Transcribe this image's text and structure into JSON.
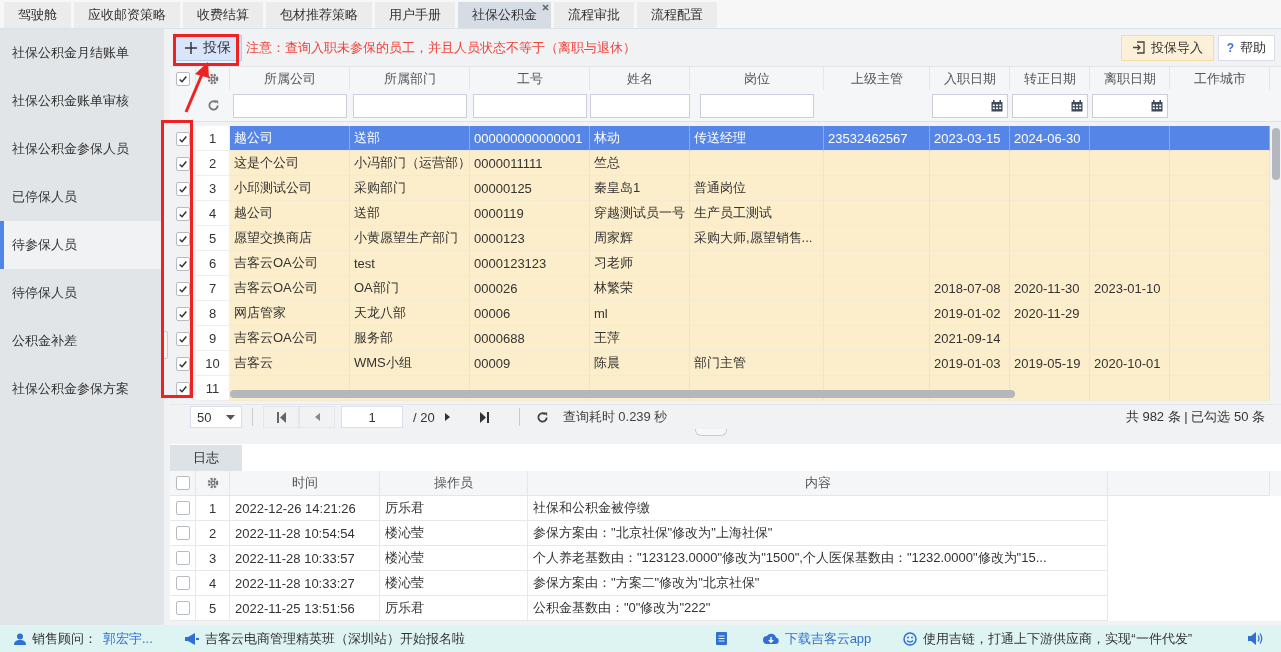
{
  "tabs": [
    {
      "label": "驾驶舱",
      "selected": false,
      "closable": false
    },
    {
      "label": "应收邮资策略",
      "selected": false,
      "closable": false
    },
    {
      "label": "收费结算",
      "selected": false,
      "closable": false
    },
    {
      "label": "包材推荐策略",
      "selected": false,
      "closable": false
    },
    {
      "label": "用户手册",
      "selected": false,
      "closable": false
    },
    {
      "label": "社保公积金",
      "selected": true,
      "closable": true
    },
    {
      "label": "流程审批",
      "selected": false,
      "closable": false
    },
    {
      "label": "流程配置",
      "selected": false,
      "closable": false
    }
  ],
  "sidebar": {
    "items": [
      {
        "label": "社保公积金月结账单",
        "selected": false
      },
      {
        "label": "社保公积金账单审核",
        "selected": false
      },
      {
        "label": "社保公积金参保人员",
        "selected": false
      },
      {
        "label": "已停保人员",
        "selected": false
      },
      {
        "label": "待参保人员",
        "selected": true
      },
      {
        "label": "待停保人员",
        "selected": false
      },
      {
        "label": "公积金补差",
        "selected": false
      },
      {
        "label": "社保公积金参保方案",
        "selected": false
      }
    ]
  },
  "toolbar": {
    "add_button": "投保",
    "notice": "注意：查询入职未参保的员工，并且人员状态不等于（离职与退休）",
    "import_button": "投保导入",
    "help_icon": "?",
    "help_button": "帮助"
  },
  "grid": {
    "all_checked": true,
    "columns": [
      {
        "label": "所属公司",
        "kind": "text"
      },
      {
        "label": "所属部门",
        "kind": "text"
      },
      {
        "label": "工号",
        "kind": "text"
      },
      {
        "label": "姓名",
        "kind": "text"
      },
      {
        "label": "岗位",
        "kind": "text"
      },
      {
        "label": "上级主管",
        "kind": "plain"
      },
      {
        "label": "入职日期",
        "kind": "date"
      },
      {
        "label": "转正日期",
        "kind": "date"
      },
      {
        "label": "离职日期",
        "kind": "date"
      },
      {
        "label": "工作城市",
        "kind": "plain"
      }
    ],
    "rows": [
      {
        "index": "1",
        "checked": true,
        "selected": true,
        "cells": [
          "越公司",
          "送部",
          "000000000000001",
          "林动",
          "传送经理",
          "23532462567",
          "2023-03-15",
          "2024-06-30",
          null,
          null
        ]
      },
      {
        "index": "2",
        "checked": true,
        "selected": false,
        "cells": [
          "这是个公司",
          "小冯部门（运营部）",
          "0000011111",
          "竺总",
          null,
          null,
          null,
          null,
          null,
          null
        ]
      },
      {
        "index": "3",
        "checked": true,
        "selected": false,
        "cells": [
          "小邱测试公司",
          "采购部门",
          "00000125",
          "秦皇岛1",
          "普通岗位",
          null,
          null,
          null,
          null,
          null
        ]
      },
      {
        "index": "4",
        "checked": true,
        "selected": false,
        "cells": [
          "越公司",
          "送部",
          "0000119",
          "穿越测试员一号",
          "生产员工测试",
          null,
          null,
          null,
          null,
          null
        ]
      },
      {
        "index": "5",
        "checked": true,
        "selected": false,
        "cells": [
          "愿望交换商店",
          "小黄愿望生产部门",
          "0000123",
          "周家辉",
          "采购大师,愿望销售...",
          null,
          null,
          null,
          null,
          null
        ]
      },
      {
        "index": "6",
        "checked": true,
        "selected": false,
        "cells": [
          "吉客云OA公司",
          "test",
          "0000123123",
          "习老师",
          null,
          null,
          null,
          null,
          null,
          null
        ]
      },
      {
        "index": "7",
        "checked": true,
        "selected": false,
        "cells": [
          "吉客云OA公司",
          "OA部门",
          "000026",
          "林繁荣",
          null,
          null,
          "2018-07-08",
          "2020-11-30",
          "2023-01-10",
          null
        ]
      },
      {
        "index": "8",
        "checked": true,
        "selected": false,
        "cells": [
          "网店管家",
          "天龙八部",
          "00006",
          "ml",
          null,
          null,
          "2019-01-02",
          "2020-11-29",
          null,
          null
        ]
      },
      {
        "index": "9",
        "checked": true,
        "selected": false,
        "cells": [
          "吉客云OA公司",
          "服务部",
          "0000688",
          "王萍",
          null,
          null,
          "2021-09-14",
          null,
          null,
          null
        ]
      },
      {
        "index": "10",
        "checked": true,
        "selected": false,
        "cells": [
          "吉客云",
          "WMS小组",
          "00009",
          "陈晨",
          "部门主管",
          null,
          "2019-01-03",
          "2019-05-19",
          "2020-10-01",
          null
        ]
      },
      {
        "index": "11",
        "checked": true,
        "selected": false,
        "cells": [
          null,
          null,
          null,
          null,
          null,
          null,
          null,
          null,
          null,
          null
        ]
      }
    ]
  },
  "pager": {
    "page_size": "50",
    "page": "1",
    "total_pages": "/ 20",
    "query_time": "查询耗时 0.239 秒",
    "summary": "共 982 条 | 已勾选 50 条"
  },
  "log": {
    "tab": "日志",
    "all_checked": false,
    "columns": [
      "时间",
      "操作员",
      "内容"
    ],
    "rows": [
      {
        "index": "1",
        "checked": false,
        "cells": [
          "2022-12-26 14:21:26",
          "厉乐君",
          "社保和公积金被停缴"
        ]
      },
      {
        "index": "2",
        "checked": false,
        "cells": [
          "2022-11-28 10:54:54",
          "楼沁莹",
          "参保方案由：\"北京社保\"修改为\"上海社保\""
        ]
      },
      {
        "index": "3",
        "checked": false,
        "cells": [
          "2022-11-28 10:33:57",
          "楼沁莹",
          "个人养老基数由：\"123123.0000\"修改为\"1500\",个人医保基数由：\"1232.0000\"修改为\"15..."
        ]
      },
      {
        "index": "4",
        "checked": false,
        "cells": [
          "2022-11-28 10:33:27",
          "楼沁莹",
          "参保方案由：\"方案二\"修改为\"北京社保\""
        ]
      },
      {
        "index": "5",
        "checked": false,
        "cells": [
          "2022-11-25 13:51:56",
          "厉乐君",
          "公积金基数由：\"0\"修改为\"222\""
        ]
      }
    ]
  },
  "status_bar": {
    "advisor_label": "销售顾问：",
    "advisor": "郭宏宇...",
    "promo": "吉客云电商管理精英班（深圳站）开始报名啦",
    "download": "下载吉客云app",
    "slogan": "使用吉链，打通上下游供应商，实现“一件代发”"
  }
}
